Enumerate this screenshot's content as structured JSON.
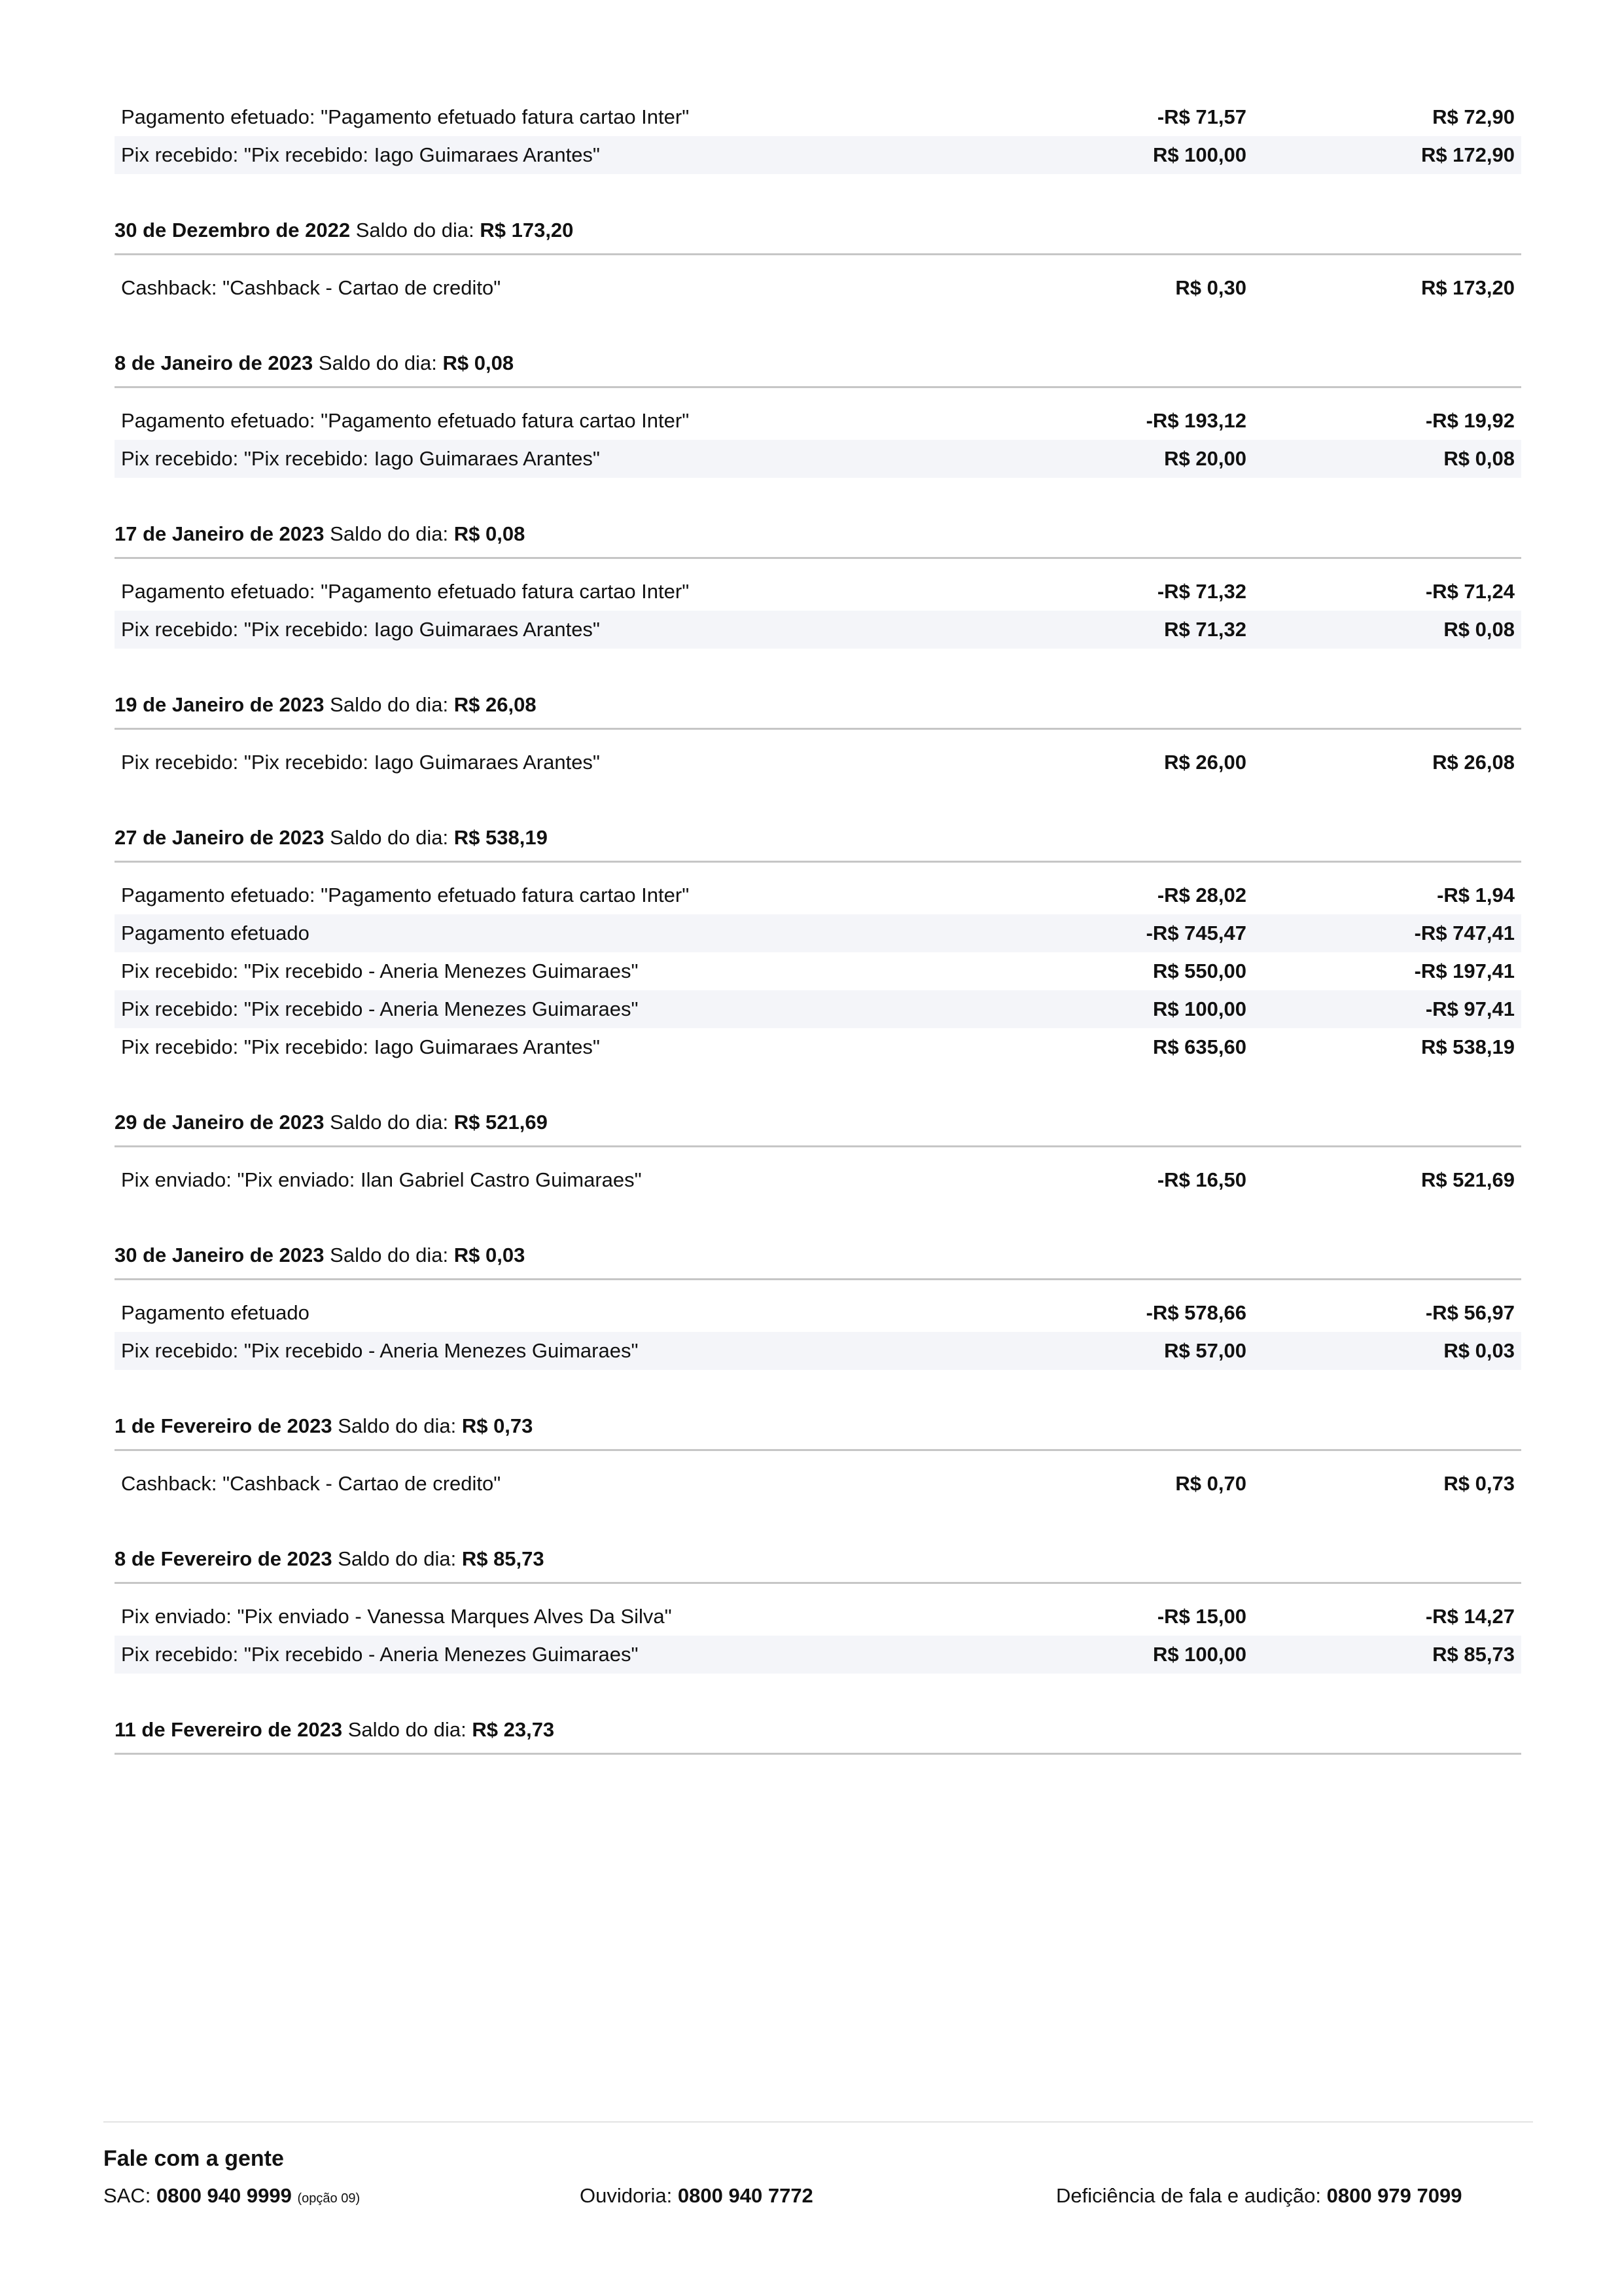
{
  "top_rows": [
    {
      "description": "Pagamento efetuado: \"Pagamento efetuado fatura cartao Inter\"",
      "amount": "-R$ 71,57",
      "balance": "R$ 72,90"
    },
    {
      "description": "Pix recebido: \"Pix recebido: Iago Guimaraes Arantes\"",
      "amount": "R$ 100,00",
      "balance": "R$ 172,90"
    }
  ],
  "day_balance_label": "Saldo do dia:",
  "days": [
    {
      "date": "30 de Dezembro de 2022",
      "balance": "R$ 173,20",
      "rows": [
        {
          "description": "Cashback: \"Cashback - Cartao de credito\"",
          "amount": "R$ 0,30",
          "balance": "R$ 173,20"
        }
      ]
    },
    {
      "date": "8 de Janeiro de 2023",
      "balance": "R$ 0,08",
      "rows": [
        {
          "description": "Pagamento efetuado: \"Pagamento efetuado fatura cartao Inter\"",
          "amount": "-R$ 193,12",
          "balance": "-R$ 19,92"
        },
        {
          "description": "Pix recebido: \"Pix recebido: Iago Guimaraes Arantes\"",
          "amount": "R$ 20,00",
          "balance": "R$ 0,08"
        }
      ]
    },
    {
      "date": "17 de Janeiro de 2023",
      "balance": "R$ 0,08",
      "rows": [
        {
          "description": "Pagamento efetuado: \"Pagamento efetuado fatura cartao Inter\"",
          "amount": "-R$ 71,32",
          "balance": "-R$ 71,24"
        },
        {
          "description": "Pix recebido: \"Pix recebido: Iago Guimaraes Arantes\"",
          "amount": "R$ 71,32",
          "balance": "R$ 0,08"
        }
      ]
    },
    {
      "date": "19 de Janeiro de 2023",
      "balance": "R$ 26,08",
      "rows": [
        {
          "description": "Pix recebido: \"Pix recebido: Iago Guimaraes Arantes\"",
          "amount": "R$ 26,00",
          "balance": "R$ 26,08"
        }
      ]
    },
    {
      "date": "27 de Janeiro de 2023",
      "balance": "R$ 538,19",
      "rows": [
        {
          "description": "Pagamento efetuado: \"Pagamento efetuado fatura cartao Inter\"",
          "amount": "-R$ 28,02",
          "balance": "-R$ 1,94"
        },
        {
          "description": "Pagamento efetuado",
          "amount": "-R$ 745,47",
          "balance": "-R$ 747,41"
        },
        {
          "description": "Pix recebido: \"Pix recebido - Aneria Menezes Guimaraes\"",
          "amount": "R$ 550,00",
          "balance": "-R$ 197,41"
        },
        {
          "description": "Pix recebido: \"Pix recebido - Aneria Menezes Guimaraes\"",
          "amount": "R$ 100,00",
          "balance": "-R$ 97,41"
        },
        {
          "description": "Pix recebido: \"Pix recebido: Iago Guimaraes Arantes\"",
          "amount": "R$ 635,60",
          "balance": "R$ 538,19"
        }
      ]
    },
    {
      "date": "29 de Janeiro de 2023",
      "balance": "R$ 521,69",
      "rows": [
        {
          "description": "Pix enviado: \"Pix enviado: Ilan Gabriel Castro Guimaraes\"",
          "amount": "-R$ 16,50",
          "balance": "R$ 521,69"
        }
      ]
    },
    {
      "date": "30 de Janeiro de 2023",
      "balance": "R$ 0,03",
      "rows": [
        {
          "description": "Pagamento efetuado",
          "amount": "-R$ 578,66",
          "balance": "-R$ 56,97"
        },
        {
          "description": "Pix recebido: \"Pix recebido - Aneria Menezes Guimaraes\"",
          "amount": "R$ 57,00",
          "balance": "R$ 0,03"
        }
      ]
    },
    {
      "date": "1 de Fevereiro de 2023",
      "balance": "R$ 0,73",
      "rows": [
        {
          "description": "Cashback: \"Cashback - Cartao de credito\"",
          "amount": "R$ 0,70",
          "balance": "R$ 0,73"
        }
      ]
    },
    {
      "date": "8 de Fevereiro de 2023",
      "balance": "R$ 85,73",
      "rows": [
        {
          "description": "Pix enviado: \"Pix enviado - Vanessa Marques Alves Da Silva\"",
          "amount": "-R$ 15,00",
          "balance": "-R$ 14,27"
        },
        {
          "description": "Pix recebido: \"Pix recebido - Aneria Menezes Guimaraes\"",
          "amount": "R$ 100,00",
          "balance": "R$ 85,73"
        }
      ]
    },
    {
      "date": "11 de Fevereiro de 2023",
      "balance": "R$ 23,73",
      "rows": []
    }
  ],
  "footer": {
    "title": "Fale com a gente",
    "sac_label": "SAC:",
    "sac_number": "0800 940 9999",
    "sac_note": "(opção 09)",
    "ouvidoria_label": "Ouvidoria:",
    "ouvidoria_number": "0800 940 7772",
    "deficiencia_label": "Deficiência de fala e audição:",
    "deficiencia_number": "0800 979 7099"
  }
}
